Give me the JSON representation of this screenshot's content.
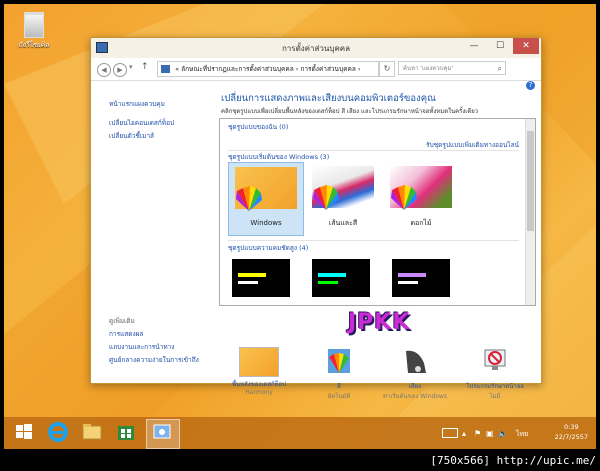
{
  "desktop": {
    "recycle_bin_label": "ถังรีไซเคิล"
  },
  "window": {
    "title": "การตั้งค่าส่วนบุคคล",
    "min": "—",
    "max": "☐",
    "close": "✕"
  },
  "address": {
    "crumb1": "ลักษณะที่ปรากฏและการตั้งค่าส่วนบุคคล",
    "crumb2": "การตั้งค่าส่วนบุคคล",
    "refresh": "↻",
    "search_placeholder": "ค้นหา 'แผงควบคุม'"
  },
  "sidebar": {
    "home": "หน้าแรกแผงควบคุม",
    "change_icons": "เปลี่ยนไอคอนเดสก์ท็อป",
    "mouse_pointer": "เปลี่ยนตัวชี้เมาส์",
    "see_also_header": "ดูเพิ่มเติม",
    "display": "การแสดงผล",
    "taskbar_nav": "แถบงานและการนำทาง",
    "ease_access": "ศูนย์กลางความง่ายในการเข้าถึง"
  },
  "main": {
    "heading": "เปลี่ยนการแสดงภาพและเสียงบนคอมพิวเตอร์ของคุณ",
    "subtext": "คลิกชุดรูปแบบเพื่อเปลี่ยนพื้นหลังของเดสก์ท็อป สี เสียง และโปรแกรมรักษาหน้าจอทั้งหมดในครั้งเดียว",
    "my_themes": "ชุดรูปแบบของฉัน (0)",
    "more_online": "รับชุดรูปแบบเพิ่มเติมทางออนไลน์",
    "windows_themes": "ชุดรูปแบบเริ่มต้นของ Windows (3)",
    "themes": [
      {
        "label": "Windows"
      },
      {
        "label": "เส้นและสี"
      },
      {
        "label": "ดอกไม้"
      }
    ],
    "hc_themes": "ชุดรูปแบบความคมชัดสูง (4)"
  },
  "bottom": {
    "items": [
      {
        "label": "พื้นหลังของเดสก์ท็อป",
        "sub": "Harmony"
      },
      {
        "label": "สี",
        "sub": "อัตโนมัติ"
      },
      {
        "label": "เสียง",
        "sub": "ค่าเริ่มต้นของ Windows"
      },
      {
        "label": "โปรแกรมรักษาหน้าจอ",
        "sub": "ไม่มี"
      }
    ]
  },
  "watermark": "JPKK",
  "taskbar": {
    "lang": "ไทย",
    "time": "0:39",
    "date": "22/7/2557"
  },
  "footer": "[750x566] http://upic.me/",
  "colors": {
    "accent": "#1d55a9",
    "close": "#c7504a",
    "wallpaper": "#f3a12e"
  }
}
